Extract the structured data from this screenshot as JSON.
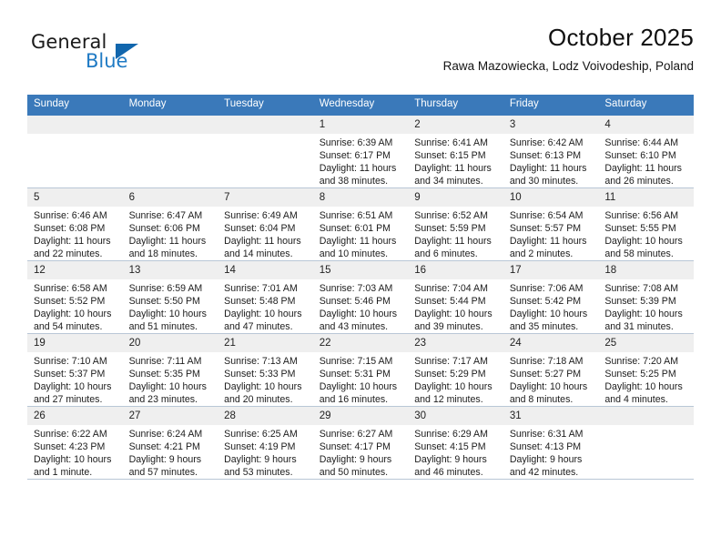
{
  "brand": {
    "name_part1": "General",
    "name_part2": "Blue",
    "triangle_color": "#1166ad",
    "blue_color": "#1f7ac4"
  },
  "header": {
    "title": "October 2025",
    "subtitle": "Rawa Mazowiecka, Lodz Voivodeship, Poland"
  },
  "calendar": {
    "accent_color": "#3a79ba",
    "daynum_background": "#efefef",
    "weekday_headers": [
      "Sunday",
      "Monday",
      "Tuesday",
      "Wednesday",
      "Thursday",
      "Friday",
      "Saturday"
    ],
    "weeks": [
      [
        {
          "day": "",
          "sunrise": "",
          "sunset": "",
          "daylight1": "",
          "daylight2": ""
        },
        {
          "day": "",
          "sunrise": "",
          "sunset": "",
          "daylight1": "",
          "daylight2": ""
        },
        {
          "day": "",
          "sunrise": "",
          "sunset": "",
          "daylight1": "",
          "daylight2": ""
        },
        {
          "day": "1",
          "sunrise": "Sunrise: 6:39 AM",
          "sunset": "Sunset: 6:17 PM",
          "daylight1": "Daylight: 11 hours",
          "daylight2": "and 38 minutes."
        },
        {
          "day": "2",
          "sunrise": "Sunrise: 6:41 AM",
          "sunset": "Sunset: 6:15 PM",
          "daylight1": "Daylight: 11 hours",
          "daylight2": "and 34 minutes."
        },
        {
          "day": "3",
          "sunrise": "Sunrise: 6:42 AM",
          "sunset": "Sunset: 6:13 PM",
          "daylight1": "Daylight: 11 hours",
          "daylight2": "and 30 minutes."
        },
        {
          "day": "4",
          "sunrise": "Sunrise: 6:44 AM",
          "sunset": "Sunset: 6:10 PM",
          "daylight1": "Daylight: 11 hours",
          "daylight2": "and 26 minutes."
        }
      ],
      [
        {
          "day": "5",
          "sunrise": "Sunrise: 6:46 AM",
          "sunset": "Sunset: 6:08 PM",
          "daylight1": "Daylight: 11 hours",
          "daylight2": "and 22 minutes."
        },
        {
          "day": "6",
          "sunrise": "Sunrise: 6:47 AM",
          "sunset": "Sunset: 6:06 PM",
          "daylight1": "Daylight: 11 hours",
          "daylight2": "and 18 minutes."
        },
        {
          "day": "7",
          "sunrise": "Sunrise: 6:49 AM",
          "sunset": "Sunset: 6:04 PM",
          "daylight1": "Daylight: 11 hours",
          "daylight2": "and 14 minutes."
        },
        {
          "day": "8",
          "sunrise": "Sunrise: 6:51 AM",
          "sunset": "Sunset: 6:01 PM",
          "daylight1": "Daylight: 11 hours",
          "daylight2": "and 10 minutes."
        },
        {
          "day": "9",
          "sunrise": "Sunrise: 6:52 AM",
          "sunset": "Sunset: 5:59 PM",
          "daylight1": "Daylight: 11 hours",
          "daylight2": "and 6 minutes."
        },
        {
          "day": "10",
          "sunrise": "Sunrise: 6:54 AM",
          "sunset": "Sunset: 5:57 PM",
          "daylight1": "Daylight: 11 hours",
          "daylight2": "and 2 minutes."
        },
        {
          "day": "11",
          "sunrise": "Sunrise: 6:56 AM",
          "sunset": "Sunset: 5:55 PM",
          "daylight1": "Daylight: 10 hours",
          "daylight2": "and 58 minutes."
        }
      ],
      [
        {
          "day": "12",
          "sunrise": "Sunrise: 6:58 AM",
          "sunset": "Sunset: 5:52 PM",
          "daylight1": "Daylight: 10 hours",
          "daylight2": "and 54 minutes."
        },
        {
          "day": "13",
          "sunrise": "Sunrise: 6:59 AM",
          "sunset": "Sunset: 5:50 PM",
          "daylight1": "Daylight: 10 hours",
          "daylight2": "and 51 minutes."
        },
        {
          "day": "14",
          "sunrise": "Sunrise: 7:01 AM",
          "sunset": "Sunset: 5:48 PM",
          "daylight1": "Daylight: 10 hours",
          "daylight2": "and 47 minutes."
        },
        {
          "day": "15",
          "sunrise": "Sunrise: 7:03 AM",
          "sunset": "Sunset: 5:46 PM",
          "daylight1": "Daylight: 10 hours",
          "daylight2": "and 43 minutes."
        },
        {
          "day": "16",
          "sunrise": "Sunrise: 7:04 AM",
          "sunset": "Sunset: 5:44 PM",
          "daylight1": "Daylight: 10 hours",
          "daylight2": "and 39 minutes."
        },
        {
          "day": "17",
          "sunrise": "Sunrise: 7:06 AM",
          "sunset": "Sunset: 5:42 PM",
          "daylight1": "Daylight: 10 hours",
          "daylight2": "and 35 minutes."
        },
        {
          "day": "18",
          "sunrise": "Sunrise: 7:08 AM",
          "sunset": "Sunset: 5:39 PM",
          "daylight1": "Daylight: 10 hours",
          "daylight2": "and 31 minutes."
        }
      ],
      [
        {
          "day": "19",
          "sunrise": "Sunrise: 7:10 AM",
          "sunset": "Sunset: 5:37 PM",
          "daylight1": "Daylight: 10 hours",
          "daylight2": "and 27 minutes."
        },
        {
          "day": "20",
          "sunrise": "Sunrise: 7:11 AM",
          "sunset": "Sunset: 5:35 PM",
          "daylight1": "Daylight: 10 hours",
          "daylight2": "and 23 minutes."
        },
        {
          "day": "21",
          "sunrise": "Sunrise: 7:13 AM",
          "sunset": "Sunset: 5:33 PM",
          "daylight1": "Daylight: 10 hours",
          "daylight2": "and 20 minutes."
        },
        {
          "day": "22",
          "sunrise": "Sunrise: 7:15 AM",
          "sunset": "Sunset: 5:31 PM",
          "daylight1": "Daylight: 10 hours",
          "daylight2": "and 16 minutes."
        },
        {
          "day": "23",
          "sunrise": "Sunrise: 7:17 AM",
          "sunset": "Sunset: 5:29 PM",
          "daylight1": "Daylight: 10 hours",
          "daylight2": "and 12 minutes."
        },
        {
          "day": "24",
          "sunrise": "Sunrise: 7:18 AM",
          "sunset": "Sunset: 5:27 PM",
          "daylight1": "Daylight: 10 hours",
          "daylight2": "and 8 minutes."
        },
        {
          "day": "25",
          "sunrise": "Sunrise: 7:20 AM",
          "sunset": "Sunset: 5:25 PM",
          "daylight1": "Daylight: 10 hours",
          "daylight2": "and 4 minutes."
        }
      ],
      [
        {
          "day": "26",
          "sunrise": "Sunrise: 6:22 AM",
          "sunset": "Sunset: 4:23 PM",
          "daylight1": "Daylight: 10 hours",
          "daylight2": "and 1 minute."
        },
        {
          "day": "27",
          "sunrise": "Sunrise: 6:24 AM",
          "sunset": "Sunset: 4:21 PM",
          "daylight1": "Daylight: 9 hours",
          "daylight2": "and 57 minutes."
        },
        {
          "day": "28",
          "sunrise": "Sunrise: 6:25 AM",
          "sunset": "Sunset: 4:19 PM",
          "daylight1": "Daylight: 9 hours",
          "daylight2": "and 53 minutes."
        },
        {
          "day": "29",
          "sunrise": "Sunrise: 6:27 AM",
          "sunset": "Sunset: 4:17 PM",
          "daylight1": "Daylight: 9 hours",
          "daylight2": "and 50 minutes."
        },
        {
          "day": "30",
          "sunrise": "Sunrise: 6:29 AM",
          "sunset": "Sunset: 4:15 PM",
          "daylight1": "Daylight: 9 hours",
          "daylight2": "and 46 minutes."
        },
        {
          "day": "31",
          "sunrise": "Sunrise: 6:31 AM",
          "sunset": "Sunset: 4:13 PM",
          "daylight1": "Daylight: 9 hours",
          "daylight2": "and 42 minutes."
        },
        {
          "day": "",
          "sunrise": "",
          "sunset": "",
          "daylight1": "",
          "daylight2": ""
        }
      ]
    ]
  }
}
